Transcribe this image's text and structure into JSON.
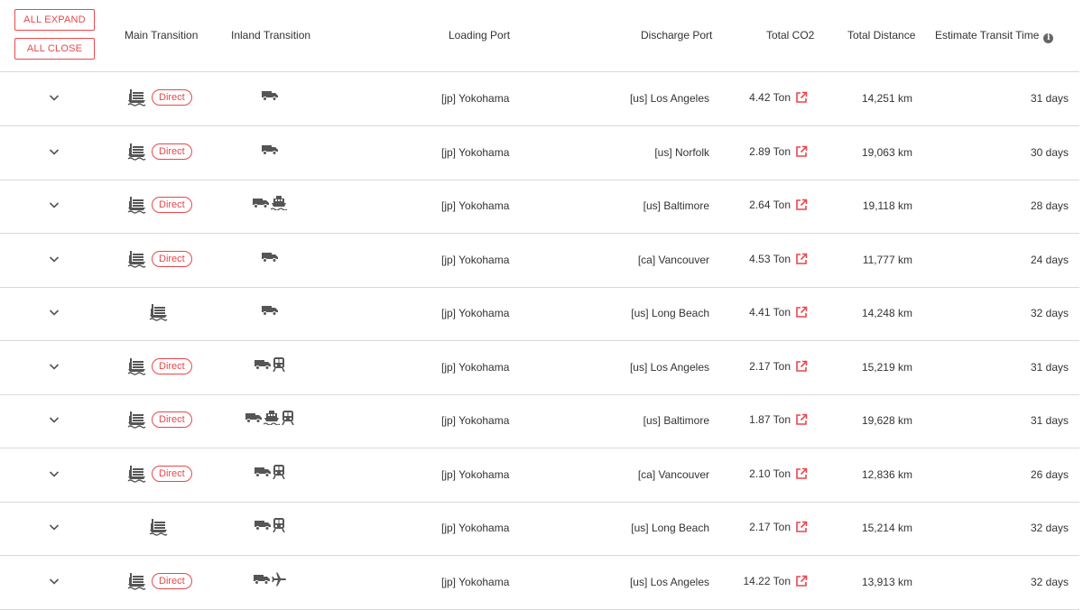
{
  "toolbar": {
    "expand_label": "ALL EXPAND",
    "close_label": "ALL CLOSE"
  },
  "columns": {
    "main": "Main Transition",
    "inland": "Inland Transition",
    "loading": "Loading Port",
    "discharge": "Discharge Port",
    "co2": "Total CO2",
    "distance": "Total Distance",
    "transit": "Estimate Transit Time"
  },
  "colors": {
    "accent": "#e8474c",
    "icon": "#555555",
    "border": "#d9d9d9"
  },
  "rows": [
    {
      "direct": true,
      "inland": [
        "truck-icon"
      ],
      "loading": "[jp] Yokohama",
      "discharge": "[us] Los Angeles",
      "co2": "4.42 Ton",
      "distance": "14,251 km",
      "transit": "31 days"
    },
    {
      "direct": true,
      "inland": [
        "truck-icon"
      ],
      "loading": "[jp] Yokohama",
      "discharge": "[us] Norfolk",
      "co2": "2.89 Ton",
      "distance": "19,063 km",
      "transit": "30 days"
    },
    {
      "direct": true,
      "inland": [
        "truck-icon",
        "ship-icon"
      ],
      "loading": "[jp] Yokohama",
      "discharge": "[us] Baltimore",
      "co2": "2.64 Ton",
      "distance": "19,118 km",
      "transit": "28 days"
    },
    {
      "direct": true,
      "inland": [
        "truck-icon"
      ],
      "loading": "[jp] Yokohama",
      "discharge": "[ca] Vancouver",
      "co2": "4.53 Ton",
      "distance": "11,777 km",
      "transit": "24 days"
    },
    {
      "direct": false,
      "inland": [
        "truck-icon"
      ],
      "loading": "[jp] Yokohama",
      "discharge": "[us] Long Beach",
      "co2": "4.41 Ton",
      "distance": "14,248 km",
      "transit": "32 days"
    },
    {
      "direct": true,
      "inland": [
        "truck-icon",
        "train-icon"
      ],
      "loading": "[jp] Yokohama",
      "discharge": "[us] Los Angeles",
      "co2": "2.17 Ton",
      "distance": "15,219 km",
      "transit": "31 days"
    },
    {
      "direct": true,
      "inland": [
        "truck-icon",
        "ship-icon",
        "train-icon"
      ],
      "loading": "[jp] Yokohama",
      "discharge": "[us] Baltimore",
      "co2": "1.87 Ton",
      "distance": "19,628 km",
      "transit": "31 days"
    },
    {
      "direct": true,
      "inland": [
        "truck-icon",
        "train-icon"
      ],
      "loading": "[jp] Yokohama",
      "discharge": "[ca] Vancouver",
      "co2": "2.10 Ton",
      "distance": "12,836 km",
      "transit": "26 days"
    },
    {
      "direct": false,
      "inland": [
        "truck-icon",
        "train-icon"
      ],
      "loading": "[jp] Yokohama",
      "discharge": "[us] Long Beach",
      "co2": "2.17 Ton",
      "distance": "15,214 km",
      "transit": "32 days"
    },
    {
      "direct": true,
      "inland": [
        "truck-icon",
        "airplane-icon"
      ],
      "loading": "[jp] Yokohama",
      "discharge": "[us] Los Angeles",
      "co2": "14.22 Ton",
      "distance": "13,913 km",
      "transit": "32 days"
    }
  ],
  "direct_label": "Direct"
}
